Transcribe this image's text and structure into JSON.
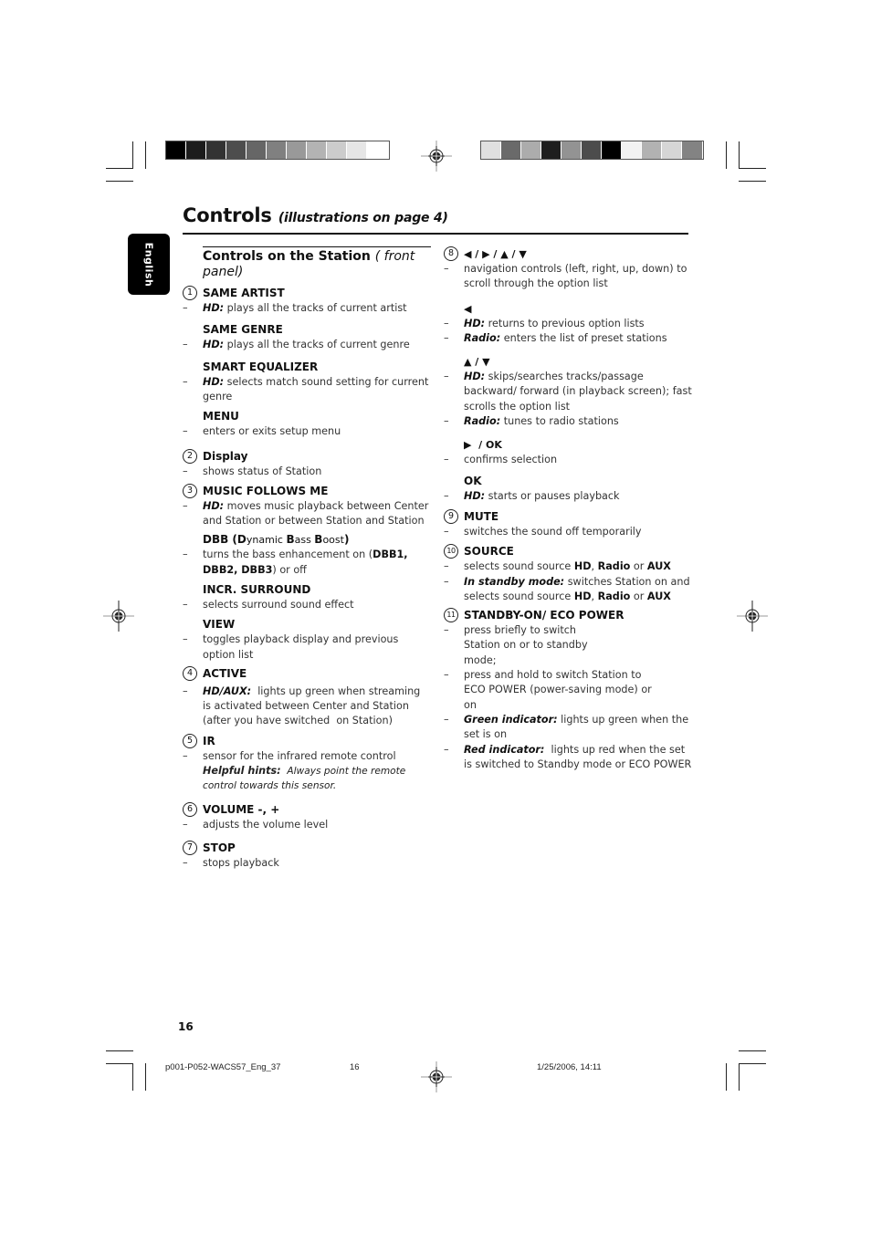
{
  "print_marks": {
    "left_bar_colors": [
      "#000000",
      "#1c1c1c",
      "#333333",
      "#4d4d4d",
      "#666666",
      "#808080",
      "#999999",
      "#b3b3b3",
      "#cccccc",
      "#e6e6e6",
      "#ffffff"
    ],
    "right_bar_colors": [
      "#e0e0e0",
      "#6a6a6a",
      "#acacac",
      "#1e1e1e",
      "#939393",
      "#4c4c4c",
      "#000000",
      "#f2f2f2",
      "#b2b2b2",
      "#d6d6d6",
      "#838383"
    ]
  },
  "header": {
    "title": "Controls",
    "subtitle": "(illustrations on page 4)",
    "language_tab": "English"
  },
  "section": {
    "title": "Controls on the Station",
    "subtitle": "( front panel)"
  },
  "left_column": {
    "item1": {
      "num": "1",
      "same_artist": {
        "label": "SAME ARTIST",
        "prefix": "HD:",
        "text": " plays all the tracks of current artist"
      },
      "same_genre": {
        "label": "SAME GENRE",
        "prefix": "HD:",
        "text": " plays all the tracks of current genre"
      },
      "smart_eq": {
        "label": "SMART EQUALIZER",
        "prefix": "HD:",
        "text": " selects match sound setting for current genre"
      },
      "menu": {
        "label": "MENU",
        "text": "enters or exits setup menu"
      }
    },
    "item2": {
      "num": "2",
      "label": "Display",
      "text": "shows status of Station"
    },
    "item3": {
      "num": "3",
      "mfm": {
        "label": "MUSIC FOLLOWS ME",
        "prefix": "HD:",
        "text": " moves music playback between Center and Station or between Station and Station"
      },
      "dbb": {
        "label_parts": [
          "DBB (",
          "D",
          "ynamic ",
          "B",
          "ass ",
          "B",
          "oost",
          ")"
        ],
        "text_before": "turns the bass enhancement on (",
        "text_bold": "DBB1, DBB2, DBB3",
        "text_after": ") or off"
      },
      "surround": {
        "label": "INCR. SURROUND",
        "text": "selects surround sound effect"
      },
      "view": {
        "label": "VIEW",
        "text": "toggles playback display and previous option list"
      }
    },
    "item4": {
      "num": "4",
      "label": "ACTIVE",
      "prefix": "HD/AUX:",
      "text": "  lights up green when streaming is activated between Center and Station (after you have switched  on Station)"
    },
    "item5": {
      "num": "5",
      "label": "IR",
      "text": "sensor for the infrared remote control",
      "hint_label": "Helpful hints:",
      "hint_text": "  Always point the remote control towards this sensor."
    },
    "item6": {
      "num": "6",
      "label": "VOLUME -, +",
      "text": "adjusts the volume level"
    },
    "item7": {
      "num": "7",
      "label": "STOP",
      "text": "stops playback"
    }
  },
  "right_column": {
    "item8": {
      "num": "8",
      "label": "◀ / ▶ / ▲ / ▼",
      "text": "navigation controls (left, right, up, down) to scroll through the option list",
      "left": {
        "label": "◀",
        "hd_prefix": "HD:",
        "hd_text": " returns to previous option lists",
        "radio_prefix": "Radio:",
        "radio_text": " enters the list of preset stations"
      },
      "updown": {
        "label": "▲ / ▼",
        "hd_prefix": "HD:",
        "hd_text": " skips/searches tracks/passage backward/ forward (in playback screen);  fast scrolls the option list",
        "radio_prefix": "Radio:",
        "radio_text": " tunes to radio stations"
      },
      "right_ok": {
        "label": "▶  / OK",
        "text": "confirms selection"
      },
      "ok": {
        "label": "OK",
        "prefix": "HD:",
        "text": " starts or pauses playback"
      }
    },
    "item9": {
      "num": "9",
      "label": "MUTE",
      "text": "switches the sound off temporarily"
    },
    "item10": {
      "num": "10",
      "label": "SOURCE",
      "line1_text": "selects sound source ",
      "line2_prefix": "In standby mode:",
      "line2_text": " switches Station on and selects sound source ",
      "src_hd": "HD",
      "src_sep": ", ",
      "src_radio": "Radio",
      "src_or": " or ",
      "src_aux": "AUX"
    },
    "item11": {
      "num": "11",
      "label": "STANDBY-ON/ ECO POWER",
      "brief": "press briefly to switch Station on or to standby mode;",
      "hold": "press and hold to switch Station to ECO POWER (power-saving mode) or on",
      "green_prefix": "Green indicator:",
      "green_text": " lights up green when the set is on",
      "red_prefix": "Red indicator:",
      "red_text": "  lights up red when the set is switched to Standby mode or ECO POWER"
    }
  },
  "footer": {
    "page_number": "16",
    "file_name": "p001-P052-WACS57_Eng_37",
    "slug_page": "16",
    "timestamp": "1/25/2006, 14:11"
  }
}
